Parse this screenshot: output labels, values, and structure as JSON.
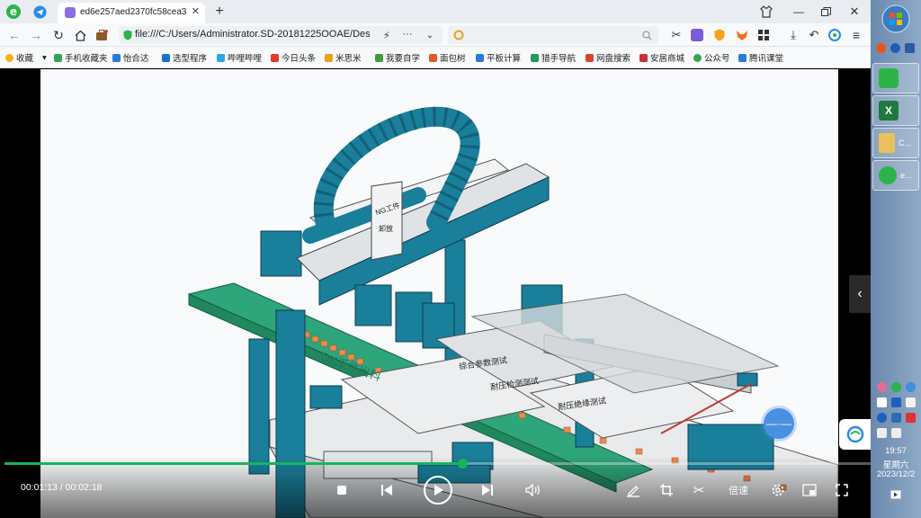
{
  "browser": {
    "tab_title": "ed6e257aed2370fc58cea38",
    "url": "file:///C:/Users/Administrator.SD-20181225OOAE/Des",
    "search_placeholder": "",
    "favorites": [
      {
        "label": "收藏",
        "color": "#f2b416"
      },
      {
        "label": "手机收藏夹",
        "color": "#3aa352"
      },
      {
        "label": "怡合达",
        "color": "#2a7bd6"
      },
      {
        "label": "选型程序",
        "color": "#1b6fd0"
      },
      {
        "label": "哔哩哔哩",
        "color": "#2aa6e0"
      },
      {
        "label": "今日头条",
        "color": "#e23b2e"
      },
      {
        "label": "米思米",
        "color": "#e8a21b"
      },
      {
        "label": "我要自学",
        "color": "#3f9b3f"
      },
      {
        "label": "面包树",
        "color": "#e05a2a"
      },
      {
        "label": "平板计算",
        "color": "#2a7bd6"
      },
      {
        "label": "猎手导航",
        "color": "#1e9a5a"
      },
      {
        "label": "网盘搜索",
        "color": "#d8452f"
      },
      {
        "label": "安居商城",
        "color": "#c23333"
      },
      {
        "label": "公众号",
        "color": "#37a64a"
      },
      {
        "label": "腾讯课堂",
        "color": "#2a7bd6"
      }
    ]
  },
  "video": {
    "current_time": "00:01:13",
    "total_time": "00:02:18",
    "time_display": "00:01:13 / 00:02:18",
    "progress": 0.529,
    "speed_label": "倍速",
    "scene_labels": {
      "ng_sign": "NG工件",
      "ng_sign2": "卸放",
      "rail_text": "OK工件出料",
      "plate1": "综合参数测试",
      "plate2": "耐压检测测试",
      "plate3": "耐压绝缘测试"
    }
  },
  "taskbar": {
    "items": [
      {
        "label": "",
        "icon": "sogou-icon"
      },
      {
        "label": "",
        "icon": "excel-icon"
      },
      {
        "label": "C...",
        "icon": "folder-icon"
      },
      {
        "label": "e...",
        "icon": "browser-icon"
      }
    ],
    "time": "19:57",
    "weekday": "星期六",
    "date": "2023/12/2"
  },
  "colors": {
    "accent_green": "#19b35d",
    "machine_teal": "#1a7f9a"
  }
}
